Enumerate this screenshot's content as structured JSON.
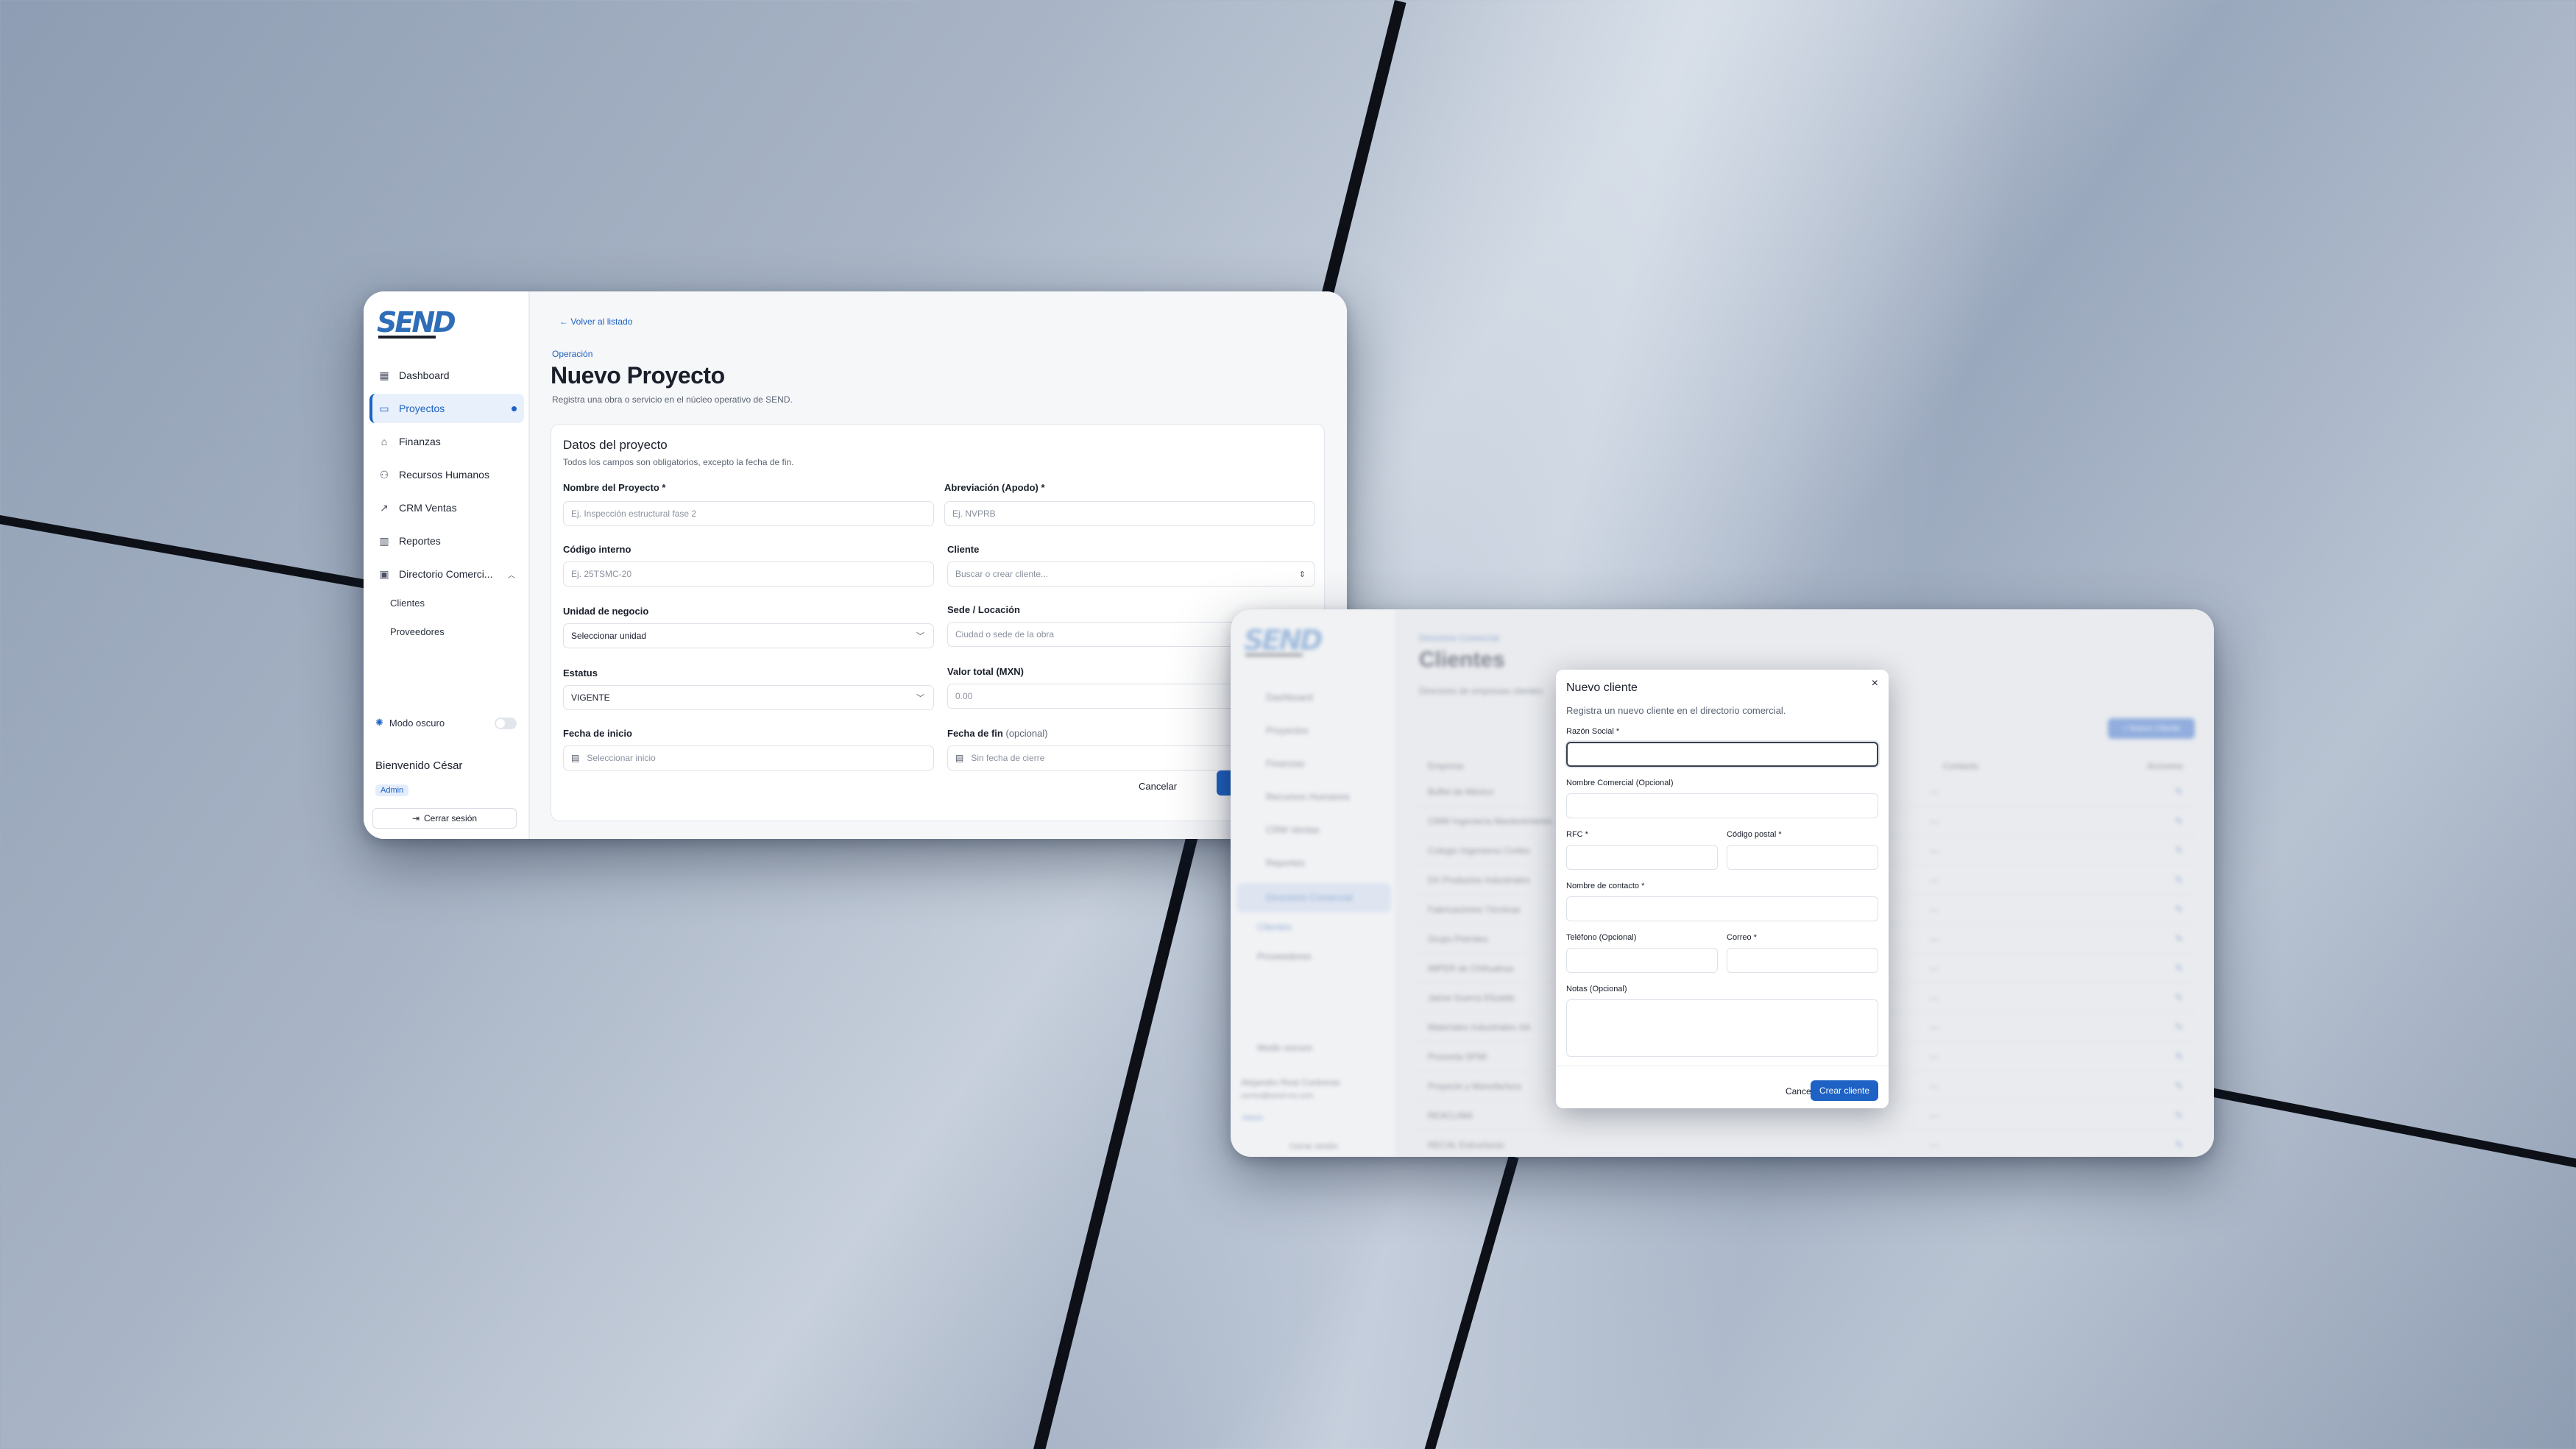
{
  "project_window": {
    "logo": "SEND",
    "nav": [
      {
        "label": "Dashboard",
        "icon": "dashboard-icon"
      },
      {
        "label": "Proyectos",
        "icon": "folder-icon"
      },
      {
        "label": "Finanzas",
        "icon": "bank-icon"
      },
      {
        "label": "Recursos Humanos",
        "icon": "users-icon"
      },
      {
        "label": "CRM Ventas",
        "icon": "trend-icon"
      },
      {
        "label": "Reportes",
        "icon": "chart-icon"
      },
      {
        "label": "Directorio Comerci...",
        "icon": "contacts-icon"
      }
    ],
    "sub_nav": [
      "Clientes",
      "Proveedores"
    ],
    "dark_mode_label": "Modo oscuro",
    "welcome": "Bienvenido César",
    "role": "Admin",
    "logout": "Cerrar sesión",
    "back": "Volver al listado",
    "eyebrow": "Operación",
    "title": "Nuevo Proyecto",
    "subtitle": "Registra una obra o servicio en el núcleo operativo de SEND.",
    "card_title": "Datos del proyecto",
    "card_sub": "Todos los campos son obligatorios, excepto la fecha de fin.",
    "fields": {
      "nombre_label": "Nombre del Proyecto *",
      "nombre_ph": "Ej. Inspección estructural fase 2",
      "abrev_label": "Abreviación (Apodo) *",
      "abrev_ph": "Ej. NVPRB",
      "codigo_label": "Código interno",
      "codigo_ph": "Ej. 25TSMC-20",
      "cliente_label": "Cliente",
      "cliente_ph": "Buscar o crear cliente...",
      "unidad_label": "Unidad de negocio",
      "unidad_ph": "Seleccionar unidad",
      "sede_label": "Sede / Locación",
      "sede_ph": "Ciudad o sede de la obra",
      "estatus_label": "Estatus",
      "estatus_val": "VIGENTE",
      "valor_label": "Valor total (MXN)",
      "valor_ph": "0.00",
      "inicio_label": "Fecha de inicio",
      "inicio_ph": "Seleccionar inicio",
      "fin_label": "Fecha de fin",
      "fin_opt": "(opcional)",
      "fin_ph": "Sin fecha de cierre"
    },
    "cancel": "Cancelar"
  },
  "clients_window": {
    "eyebrow": "Directorio Comercial",
    "title": "Clientes",
    "subtitle": "Directorio de empresas clientes",
    "new_button": "+ Nuevo Cliente",
    "columns": [
      "Empresa",
      "Contacto",
      "Acciones"
    ],
    "rows": [
      "Buffet de México",
      "CMW Ingeniería Mantenimiento",
      "Colegio Ingenieros Civiles",
      "DX Productos Industriales",
      "Fabricaciones Técnicas",
      "Grupo Petroleo",
      "IMPER de Chihuahua",
      "Jaime Guerra Elizalde",
      "Materiales Industriales SA",
      "Proveeta SFMI",
      "Proyecto y Manufactura",
      "REACLIMA",
      "RECAL Estructuras"
    ],
    "nav": [
      "Dashboard",
      "Proyectos",
      "Finanzas",
      "Recursos Humanos",
      "CRM Ventas",
      "Reportes",
      "Directorio Comercial"
    ],
    "sub_nav": [
      "Clientes",
      "Proveedores"
    ],
    "dark_mode_label": "Modo oscuro",
    "user_name": "Alejandro Real Contreras",
    "user_email": "correo@send-mx.com",
    "role": "Admin",
    "logout": "Cerrar sesión"
  },
  "modal": {
    "title": "Nuevo cliente",
    "subtitle": "Registra un nuevo cliente en el directorio comercial.",
    "razon": "Razón Social *",
    "comercial": "Nombre Comercial (Opcional)",
    "rfc": "RFC *",
    "cp": "Código postal *",
    "contacto": "Nombre de contacto *",
    "telefono": "Teléfono (Opcional)",
    "correo": "Correo *",
    "notas": "Notas (Opcional)",
    "cancel": "Cancelar",
    "create": "Crear cliente"
  },
  "colors": {
    "accent": "#1d62c4",
    "surface": "#ffffff"
  }
}
